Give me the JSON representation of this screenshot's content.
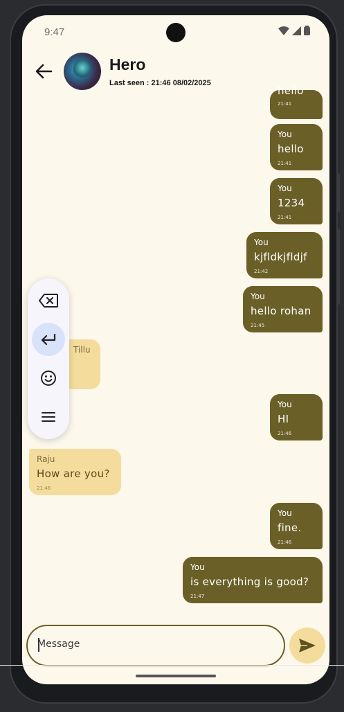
{
  "status": {
    "time": "9:47"
  },
  "header": {
    "name": "Hero",
    "last_seen": "Last seen : 21:46 08/02/2025"
  },
  "messages": [
    {
      "dir": "out",
      "sender": "",
      "text": "hello",
      "time": "21:41",
      "partial": true
    },
    {
      "dir": "out",
      "sender": "You",
      "text": "hello",
      "time": "21:41"
    },
    {
      "dir": "out",
      "sender": "You",
      "text": "1234",
      "time": "21:41"
    },
    {
      "dir": "out",
      "sender": "You",
      "text": "kjfldkjfldjf",
      "time": "21:42"
    },
    {
      "dir": "out",
      "sender": "You",
      "text": "hello rohan",
      "time": "21:45"
    },
    {
      "dir": "in",
      "sender": "Tillu",
      "text": "",
      "time": ""
    },
    {
      "dir": "out",
      "sender": "You",
      "text": "HI",
      "time": "21:46"
    },
    {
      "dir": "in",
      "sender": "Raju",
      "text": "How are you?",
      "time": "21:46"
    },
    {
      "dir": "out",
      "sender": "You",
      "text": "fine.",
      "time": "21:46"
    },
    {
      "dir": "out",
      "sender": "You",
      "text": "is everything is good?",
      "time": "21:47"
    }
  ],
  "composer": {
    "placeholder": "Message"
  },
  "keyboard_toolbar": [
    "backspace-icon",
    "enter-icon",
    "emoji-icon",
    "menu-icon"
  ],
  "colors": {
    "outgoing": "#6b5f28",
    "incoming": "#f4dd9c",
    "background": "#fdf8ec",
    "active_key": "#d9e2fb"
  }
}
